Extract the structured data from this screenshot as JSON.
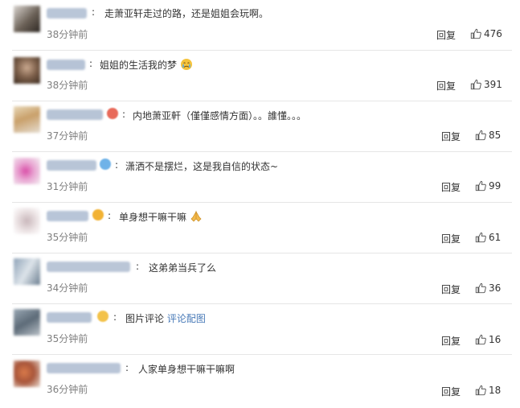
{
  "comments": [
    {
      "text": "走萧亚轩走过的路，还是姐姐会玩啊。",
      "time": "38分钟前",
      "reply": "回复",
      "likes": "476"
    },
    {
      "text": "姐姐的生活我的梦",
      "time": "38分钟前",
      "reply": "回复",
      "likes": "391"
    },
    {
      "text": "内地萧亚軒（僅僅感情方面）。。誰懂。。。",
      "time": "37分钟前",
      "reply": "回复",
      "likes": "85"
    },
    {
      "text": "潇洒不是摆烂，这是我自信的状态~",
      "time": "31分钟前",
      "reply": "回复",
      "likes": "99"
    },
    {
      "text": "单身想干嘛干嘛",
      "time": "35分钟前",
      "reply": "回复",
      "likes": "61"
    },
    {
      "text": "这弟弟当兵了么",
      "time": "34分钟前",
      "reply": "回复",
      "likes": "36"
    },
    {
      "text": "图片评论",
      "link": "评论配图",
      "time": "35分钟前",
      "reply": "回复",
      "likes": "16"
    },
    {
      "text": "人家单身想干嘛干嘛啊",
      "time": "36分钟前",
      "reply": "回复",
      "likes": "18"
    }
  ],
  "colors": {
    "link": "#4a7bb8",
    "time": "#808080",
    "divider": "#e6e6e6"
  },
  "icons": {
    "like": "thumbs-up-icon",
    "emoji_row2": "crying-face-icon",
    "emoji_row5": "praying-hands-icon"
  }
}
